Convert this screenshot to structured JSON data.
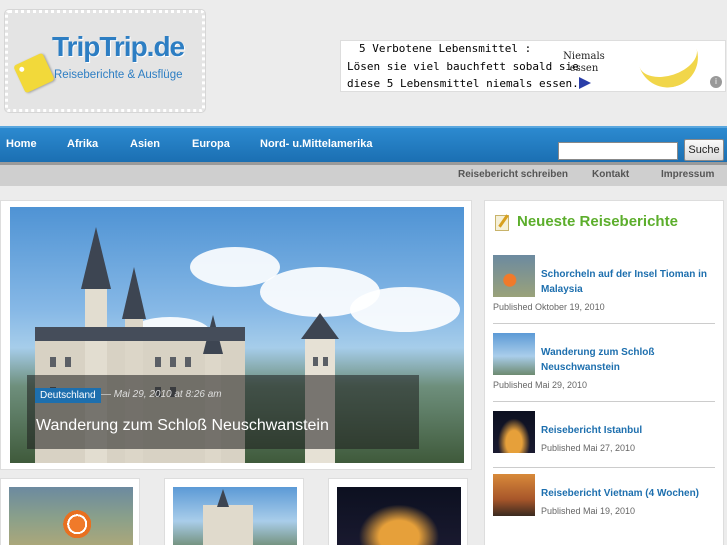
{
  "header": {
    "logo_name": "TripTrip.de",
    "logo_subtitle": "Reiseberichte & Ausflüge",
    "ad": {
      "line1": "5 Verbotene Lebensmittel :",
      "line2": "Lösen sie viel bauchfett sobald sie",
      "line3": "diese 5 Lebensmittel niemals essen.",
      "side_text": "Niemals essen",
      "info_glyph": "i"
    }
  },
  "nav": {
    "items": [
      {
        "label": "Home"
      },
      {
        "label": "Afrika"
      },
      {
        "label": "Asien"
      },
      {
        "label": "Europa"
      },
      {
        "label": "Nord- u.Mittelamerika"
      }
    ],
    "search_placeholder": "",
    "search_button": "Suche"
  },
  "subnav": {
    "items": [
      {
        "label": "Reisebericht schreiben"
      },
      {
        "label": "Kontakt"
      },
      {
        "label": "Impressum"
      }
    ]
  },
  "feature": {
    "category": "Deutschland",
    "meta": "— Mai 29, 2010 at 8:26 am",
    "title": "Wanderung zum Schloß Neuschwanstein"
  },
  "sidebar": {
    "title": "Neueste Reiseberichte",
    "items": [
      {
        "title": "Schorcheln auf der Insel Tioman in Malaysia",
        "published": "Published Oktober 19, 2010"
      },
      {
        "title": "Wanderung zum Schloß Neuschwanstein",
        "published": "Published Mai 29, 2010"
      },
      {
        "title": "Reisebericht Istanbul",
        "published": "Published Mai 27, 2010"
      },
      {
        "title": "Reisebericht Vietnam (4 Wochen)",
        "published": "Published Mai 19, 2010"
      }
    ]
  },
  "colors": {
    "nav_blue": "#1b6fb2",
    "link_blue": "#1d6fae",
    "sidebar_green": "#5cae2c"
  }
}
